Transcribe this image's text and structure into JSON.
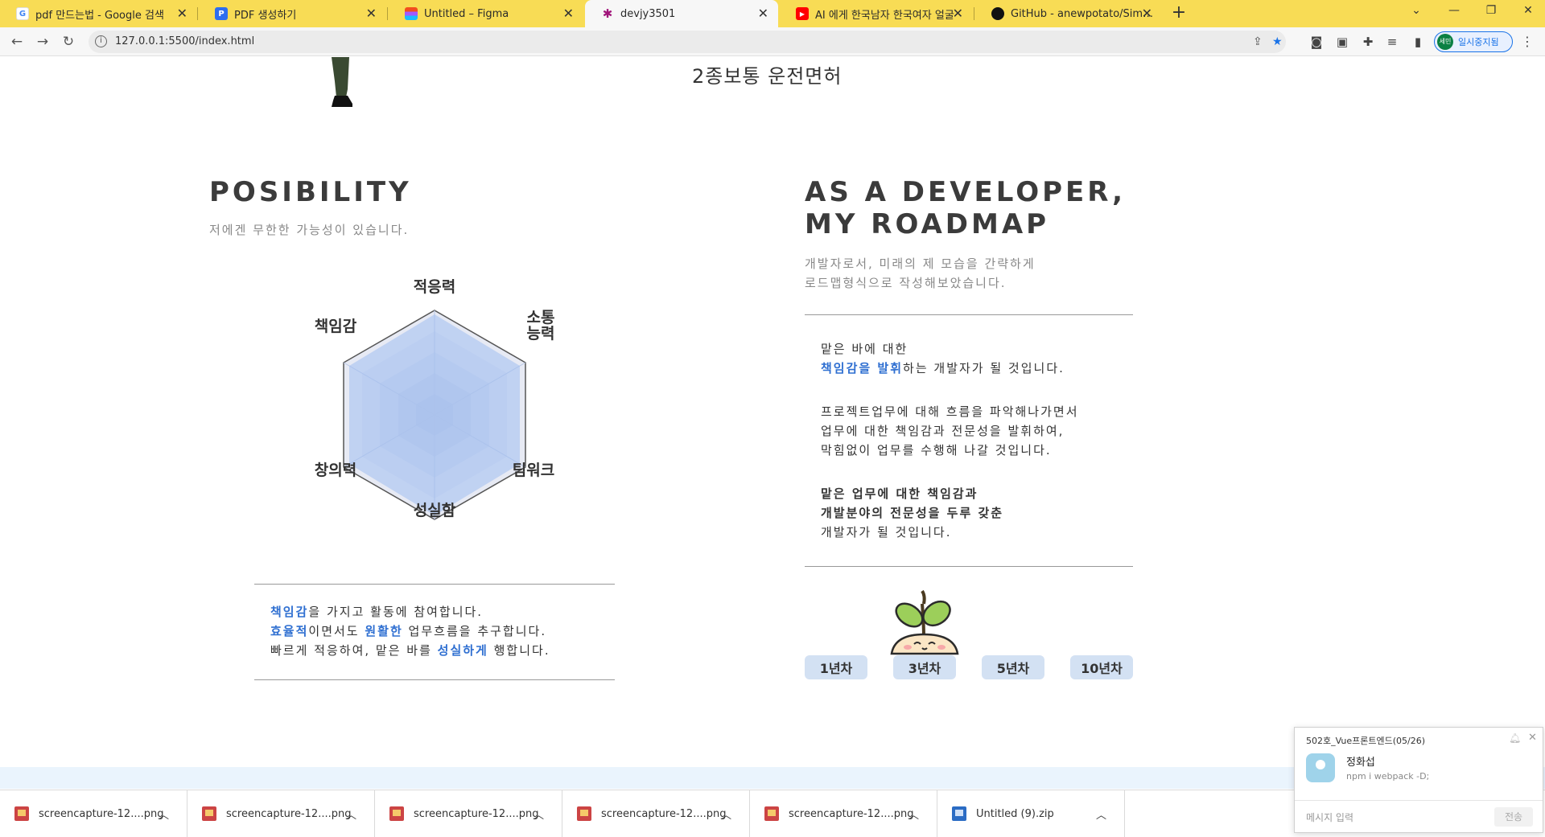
{
  "browser": {
    "tabs": [
      {
        "title": "pdf 만드는법 - Google 검색",
        "icon": "google-icon"
      },
      {
        "title": "PDF 생성하기",
        "icon": "doc-icon"
      },
      {
        "title": "Untitled – Figma",
        "icon": "figma-icon"
      },
      {
        "title": "devjy3501",
        "icon": "star-icon"
      },
      {
        "title": "AI 에게 한국남자 한국여자 얼굴",
        "icon": "youtube-icon"
      },
      {
        "title": "GitHub - anewpotato/Simple-C",
        "icon": "github-icon"
      }
    ],
    "active_tab": 3,
    "url": "127.0.0.1:5500/index.html",
    "profile_badge": "세민",
    "profile_label": "일시중지됨"
  },
  "page": {
    "license": "2종보통 운전면허",
    "posibility": {
      "title": "POSIBILITY",
      "subtitle": "저에겐 무한한 가능성이 있습니다.",
      "radar_labels": {
        "top": "적응력",
        "top_right_1": "소통",
        "top_right_2": "능력",
        "bottom_right": "팀워크",
        "bottom": "성실함",
        "bottom_left": "창의력",
        "top_left": "책임감"
      },
      "lines": [
        {
          "b1": "책임감",
          "t1": "을 가지고 활동에 참여합니다."
        },
        {
          "b1": "효율적",
          "t1": "이면서도 ",
          "b2": "원활한",
          "t2": " 업무흐름을 추구합니다."
        },
        {
          "t0": "빠르게 적응하여, 맡은 바를 ",
          "b1": "성실하게",
          "t1": " 행합니다."
        }
      ]
    },
    "roadmap": {
      "title_line1": "AS A DEVELOPER,",
      "title_line2": "MY ROADMAP",
      "subtitle_line1": "개발자로서, 미래의 제 모습을 간략하게",
      "subtitle_line2": "로드맵형식으로 작성해보았습니다.",
      "para1_line1": "맡은 바에 대한",
      "para1_line2_blue": "책임감을 발휘",
      "para1_line2_rest": "하는 개발자가 될 것입니다.",
      "para2_line1": "프로젝트업무에 대해 흐름을 파악해나가면서",
      "para2_line2": "업무에 대한 책임감과 전문성을 발휘하여,",
      "para2_line3": "막힘없이 업무를 수행해 나갈 것입니다.",
      "para3_line1": "맡은 업무에 대한 책임감과",
      "para3_line2": "개발분야의 전문성을 두루 갖춘",
      "para3_line3": "개발자가 될 것입니다.",
      "years": [
        "1년차",
        "3년차",
        "5년차",
        "10년차"
      ]
    }
  },
  "downloads": [
    "screencapture-12....png",
    "screencapture-12....png",
    "screencapture-12....png",
    "screencapture-12....png",
    "screencapture-12....png",
    "Untitled (9).zip"
  ],
  "chat": {
    "room": "502호_Vue프론트엔드(05/26)",
    "sender": "정화섭",
    "message": "npm i webpack -D;",
    "input_placeholder": "메시지 입력",
    "send_label": "전송"
  },
  "colors": {
    "tabbar": "#f8dc55",
    "accent_blue": "#2f6fd1",
    "highlight": "#cfe0f7",
    "year_button": "#d3e1f3"
  }
}
